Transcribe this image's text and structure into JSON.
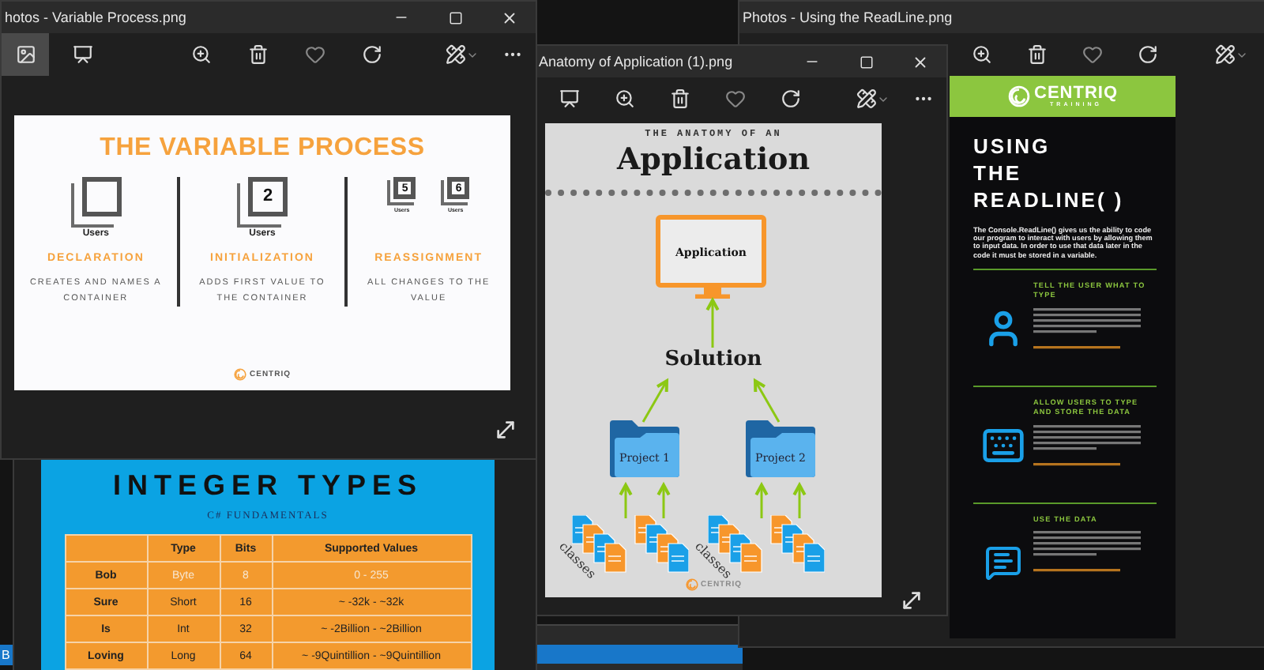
{
  "background_window": {
    "label": "B"
  },
  "readline_window": {
    "title": "Photos - Using the ReadLine.png",
    "image": {
      "logo": "CENTRIQ",
      "logo_tagline": "TRAINING",
      "heading_lines": [
        "USING",
        "THE",
        "READLINE( )"
      ],
      "intro": "The Console.ReadLine() gives us the ability to code our program to interact with users by allowing them to input data. In order to use that data later in the code it must be stored in a variable.",
      "sections": [
        {
          "kind": "person",
          "heading": "TELL THE USER WHAT TO TYPE"
        },
        {
          "kind": "keyboard",
          "heading": "ALLOW USERS TO TYPE AND STORE THE DATA"
        },
        {
          "kind": "message",
          "heading": "USE THE DATA"
        }
      ]
    }
  },
  "anatomy_window": {
    "title": "Anatomy of Application (1).png",
    "image": {
      "kicker": "THE ANATOMY OF AN",
      "heading": "Application",
      "monitor": "Application",
      "solution": "Solution",
      "projects": [
        {
          "name": "Project 1",
          "classes_label": "classes"
        },
        {
          "name": "Project 2",
          "classes_label": "classes"
        }
      ],
      "logo": "CENTRIQ"
    }
  },
  "integer_types_window": {
    "heading": "INTEGER TYPES",
    "subtitle": "C# FUNDAMENTALS",
    "columns": [
      "Type",
      "Bits",
      "Supported Values"
    ],
    "rows": [
      {
        "name": "Bob",
        "cells": [
          "Byte",
          "8",
          "0 - 255"
        ]
      },
      {
        "name": "Sure",
        "cells": [
          "Short",
          "16",
          "~ -32k - ~32k"
        ]
      },
      {
        "name": "Is",
        "cells": [
          "Int",
          "32",
          "~ -2Billion - ~2Billion"
        ]
      },
      {
        "name": "Loving",
        "cells": [
          "Long",
          "64",
          "~ -9Quintillion - ~9Quintillion"
        ]
      }
    ]
  },
  "variable_process_window": {
    "title": "hotos - Variable Process.png",
    "image": {
      "heading": "THE VARIABLE PROCESS",
      "steps": [
        {
          "boxes": [
            {
              "caption": "Users"
            }
          ],
          "name": "DECLARATION",
          "description": "CREATES AND NAMES A CONTAINER"
        },
        {
          "boxes": [
            {
              "digit": "2",
              "caption": "Users"
            }
          ],
          "name": "INITIALIZATION",
          "description": "ADDS FIRST VALUE TO THE CONTAINER"
        },
        {
          "boxes": [
            {
              "digit": "5",
              "caption": "Users"
            },
            {
              "digit": "6",
              "caption": "Users"
            }
          ],
          "name": "REASSIGNMENT",
          "description": "ALL CHANGES TO THE VALUE"
        }
      ],
      "logo": "CENTRIQ"
    }
  }
}
